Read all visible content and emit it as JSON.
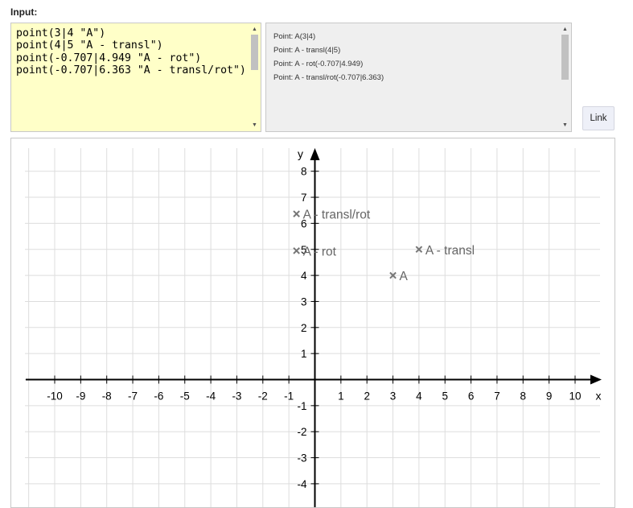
{
  "input_label": "Input:",
  "code_lines": [
    "point(3|4 \"A\")",
    "point(4|5 \"A - transl\")",
    "point(-0.707|4.949 \"A - rot\")",
    "point(-0.707|6.363 \"A - transl/rot\")"
  ],
  "output_lines": [
    "Point: A(3|4)",
    "Point: A - transl(4|5)",
    "Point: A - rot(-0.707|4.949)",
    "Point: A - transl/rot(-0.707|6.363)"
  ],
  "link_label": "Link",
  "scroll_up_glyph": "▲",
  "scroll_down_glyph": "▼",
  "colors": {
    "code_bg": "#ffffc8",
    "output_bg": "#efefef",
    "grid": "#dddddd",
    "axis": "#000000",
    "point": "#777777"
  },
  "chart_data": {
    "type": "scatter",
    "xlabel": "x",
    "ylabel": "y",
    "xlim": [
      -10,
      10
    ],
    "ylim": [
      -4,
      8
    ],
    "x_ticks": [
      -10,
      -9,
      -8,
      -7,
      -6,
      -5,
      -4,
      -3,
      -2,
      -1,
      1,
      2,
      3,
      4,
      5,
      6,
      7,
      8,
      9,
      10
    ],
    "y_ticks": [
      -4,
      -3,
      -2,
      -1,
      1,
      2,
      3,
      4,
      5,
      6,
      7,
      8
    ],
    "grid": true,
    "marker": "x",
    "points": [
      {
        "label": "A",
        "x": 3,
        "y": 4
      },
      {
        "label": "A - transl",
        "x": 4,
        "y": 5
      },
      {
        "label": "A - rot",
        "x": -0.707,
        "y": 4.949
      },
      {
        "label": "A - transl/rot",
        "x": -0.707,
        "y": 6.363
      }
    ]
  }
}
